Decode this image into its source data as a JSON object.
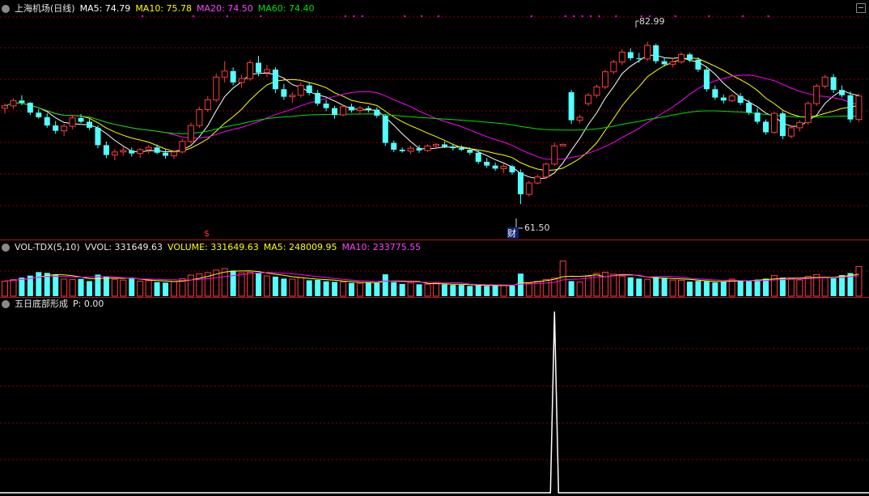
{
  "main_header": {
    "title": "上海机场(日线)",
    "ma5": "MA5: 74.79",
    "ma10": "MA10: 75.78",
    "ma20": "MA20: 74.50",
    "ma60": "MA60: 74.40"
  },
  "vol_header": {
    "name": "VOL-TDX(5,10)",
    "vvol": "VVOL: 331649.63",
    "volume": "VOLUME: 331649.63",
    "ma5": "MA5: 248009.95",
    "ma10": "MA10: 233775.55"
  },
  "ind_header": {
    "name": "五日底部形成",
    "p": "P: 0.00"
  },
  "annotations": {
    "high_label": "82.99",
    "low_label": "61.50",
    "finance_mark": "财",
    "dividend_mark": "$"
  },
  "colors": {
    "up": "#ff3c3c",
    "down": "#54ffff",
    "ma5": "#ffffff",
    "ma10": "#ffff00",
    "ma20": "#ff00ff",
    "ma60": "#00e000",
    "grid": "#8b0000"
  },
  "chart_data": {
    "type": "candlestick",
    "price_range": [
      58,
      87
    ],
    "candles": [
      [
        74.2,
        74.8,
        73.5,
        74.5
      ],
      [
        74.5,
        75.5,
        74.1,
        75.2
      ],
      [
        75.2,
        75.9,
        74.6,
        74.9
      ],
      [
        74.9,
        75.0,
        73.3,
        73.6
      ],
      [
        73.6,
        74.1,
        72.8,
        73.0
      ],
      [
        73.0,
        73.5,
        71.6,
        71.9
      ],
      [
        71.9,
        72.5,
        70.8,
        71.2
      ],
      [
        71.2,
        72.1,
        70.5,
        71.8
      ],
      [
        71.8,
        73.3,
        71.4,
        72.9
      ],
      [
        72.9,
        73.4,
        72.2,
        72.4
      ],
      [
        72.4,
        72.8,
        71.3,
        71.6
      ],
      [
        71.6,
        71.9,
        68.9,
        69.3
      ],
      [
        69.3,
        69.8,
        67.6,
        68.0
      ],
      [
        68.0,
        68.8,
        67.3,
        68.4
      ],
      [
        68.4,
        69.1,
        67.9,
        68.6
      ],
      [
        68.6,
        69.0,
        67.8,
        68.2
      ],
      [
        68.2,
        68.9,
        67.6,
        68.7
      ],
      [
        68.7,
        69.3,
        68.2,
        69.0
      ],
      [
        69.0,
        69.4,
        68.1,
        68.3
      ],
      [
        68.3,
        68.7,
        67.5,
        67.9
      ],
      [
        67.9,
        68.6,
        67.5,
        68.4
      ],
      [
        68.4,
        70.1,
        68.2,
        69.8
      ],
      [
        69.8,
        72.3,
        69.5,
        71.9
      ],
      [
        71.9,
        74.4,
        71.6,
        74.0
      ],
      [
        74.0,
        75.8,
        73.7,
        75.3
      ],
      [
        75.3,
        78.8,
        75.0,
        78.3
      ],
      [
        78.3,
        80.4,
        77.6,
        79.1
      ],
      [
        79.1,
        79.6,
        77.2,
        77.6
      ],
      [
        77.6,
        78.6,
        76.9,
        78.1
      ],
      [
        78.1,
        80.6,
        77.8,
        80.2
      ],
      [
        80.2,
        81.1,
        78.4,
        78.9
      ],
      [
        78.9,
        79.9,
        78.3,
        79.3
      ],
      [
        79.3,
        79.6,
        76.2,
        76.7
      ],
      [
        76.7,
        77.4,
        75.3,
        75.7
      ],
      [
        75.7,
        76.3,
        74.9,
        75.9
      ],
      [
        75.9,
        77.6,
        75.6,
        77.2
      ],
      [
        77.2,
        77.6,
        75.9,
        76.2
      ],
      [
        76.2,
        76.6,
        74.5,
        74.8
      ],
      [
        74.8,
        75.3,
        73.8,
        74.2
      ],
      [
        74.2,
        74.5,
        72.8,
        73.3
      ],
      [
        73.3,
        74.6,
        73.1,
        74.4
      ],
      [
        74.4,
        74.8,
        73.6,
        73.9
      ],
      [
        73.9,
        74.5,
        73.5,
        74.2
      ],
      [
        74.2,
        74.5,
        73.6,
        74.0
      ],
      [
        74.0,
        74.3,
        72.9,
        73.2
      ],
      [
        73.2,
        73.4,
        69.2,
        69.6
      ],
      [
        69.6,
        69.9,
        68.4,
        68.7
      ],
      [
        68.7,
        69.0,
        68.3,
        68.5
      ],
      [
        68.5,
        69.2,
        68.1,
        68.9
      ],
      [
        68.9,
        69.3,
        68.3,
        68.6
      ],
      [
        68.6,
        69.4,
        68.4,
        69.2
      ],
      [
        69.2,
        69.6,
        68.8,
        69.4
      ],
      [
        69.4,
        69.8,
        68.9,
        69.1
      ],
      [
        69.1,
        69.5,
        68.6,
        68.9
      ],
      [
        68.9,
        69.3,
        68.5,
        68.7
      ],
      [
        68.7,
        69.0,
        68.0,
        68.3
      ],
      [
        68.3,
        68.6,
        66.8,
        67.1
      ],
      [
        67.1,
        67.6,
        66.3,
        66.6
      ],
      [
        66.6,
        67.0,
        65.9,
        66.2
      ],
      [
        66.2,
        66.8,
        65.6,
        66.5
      ],
      [
        66.5,
        66.7,
        65.4,
        65.7
      ],
      [
        65.7,
        66.1,
        61.5,
        62.8
      ],
      [
        62.8,
        64.6,
        62.5,
        64.3
      ],
      [
        64.3,
        65.4,
        64.1,
        65.1
      ],
      [
        65.1,
        67.0,
        64.9,
        66.8
      ],
      [
        66.8,
        69.6,
        66.6,
        69.2
      ],
      [
        69.2,
        69.5,
        69.2,
        69.4
      ],
      [
        76.3,
        76.6,
        72.1,
        72.6
      ],
      [
        72.6,
        73.3,
        72.2,
        73.0
      ],
      [
        74.8,
        76.2,
        74.5,
        75.9
      ],
      [
        75.9,
        77.3,
        75.6,
        77.0
      ],
      [
        77.0,
        79.3,
        76.7,
        79.0
      ],
      [
        79.0,
        80.6,
        78.7,
        80.3
      ],
      [
        80.3,
        82.0,
        79.9,
        81.6
      ],
      [
        81.6,
        82.1,
        80.5,
        80.8
      ],
      [
        80.8,
        81.5,
        80.2,
        80.7
      ],
      [
        80.7,
        82.99,
        80.4,
        82.5
      ],
      [
        82.5,
        82.7,
        80.1,
        80.4
      ],
      [
        80.4,
        80.9,
        79.7,
        80.0
      ],
      [
        80.0,
        80.8,
        79.6,
        80.3
      ],
      [
        80.3,
        81.6,
        80.1,
        81.3
      ],
      [
        81.3,
        81.5,
        80.3,
        80.6
      ],
      [
        80.6,
        80.9,
        79.0,
        79.3
      ],
      [
        79.3,
        79.6,
        76.4,
        76.7
      ],
      [
        76.7,
        77.2,
        75.3,
        75.6
      ],
      [
        75.6,
        76.0,
        74.8,
        75.2
      ],
      [
        75.2,
        76.1,
        75.0,
        75.8
      ],
      [
        75.8,
        76.2,
        74.6,
        74.9
      ],
      [
        74.9,
        75.3,
        73.3,
        73.6
      ],
      [
        73.6,
        74.2,
        72.1,
        72.4
      ],
      [
        72.4,
        72.7,
        70.7,
        71.0
      ],
      [
        71.0,
        73.7,
        70.8,
        73.5
      ],
      [
        73.5,
        73.8,
        70.1,
        70.5
      ],
      [
        70.5,
        71.9,
        70.2,
        71.6
      ],
      [
        71.6,
        72.6,
        71.1,
        72.3
      ],
      [
        72.3,
        75.1,
        72.0,
        74.8
      ],
      [
        74.8,
        77.4,
        74.5,
        77.1
      ],
      [
        77.1,
        78.6,
        76.8,
        78.3
      ],
      [
        78.3,
        78.7,
        76.2,
        76.6
      ],
      [
        76.6,
        77.2,
        75.6,
        75.9
      ],
      [
        75.9,
        76.4,
        72.3,
        72.7
      ],
      [
        72.7,
        76.1,
        72.4,
        75.8
      ]
    ],
    "volume_range": [
      0,
      420000
    ],
    "volumes": [
      150000,
      165000,
      185000,
      205000,
      240000,
      232000,
      215000,
      170000,
      165000,
      172000,
      150000,
      215000,
      195000,
      168000,
      160000,
      175000,
      150000,
      155000,
      140000,
      135000,
      145000,
      175000,
      210000,
      222000,
      235000,
      260000,
      275000,
      255000,
      232000,
      238000,
      228000,
      202000,
      195000,
      175000,
      170000,
      185000,
      158000,
      162000,
      148000,
      142000,
      142000,
      132000,
      128000,
      138000,
      132000,
      218000,
      140000,
      122000,
      132000,
      118000,
      120000,
      130000,
      118000,
      112000,
      112000,
      102000,
      108000,
      102000,
      110000,
      108000,
      105000,
      225000,
      128000,
      148000,
      165000,
      180000,
      350000,
      150000,
      142000,
      198000,
      228000,
      238000,
      220000,
      200000,
      188000,
      175000,
      168000,
      190000,
      182000,
      160000,
      158000,
      145000,
      152000,
      148000,
      138000,
      145000,
      170000,
      158000,
      158000,
      165000,
      175000,
      205000,
      185000,
      172000,
      162000,
      198000,
      215000,
      188000,
      178000,
      210000,
      230000,
      295000
    ],
    "indicator": {
      "name": "五日底部形成",
      "spike_index": 65,
      "spike_value": 1
    }
  }
}
